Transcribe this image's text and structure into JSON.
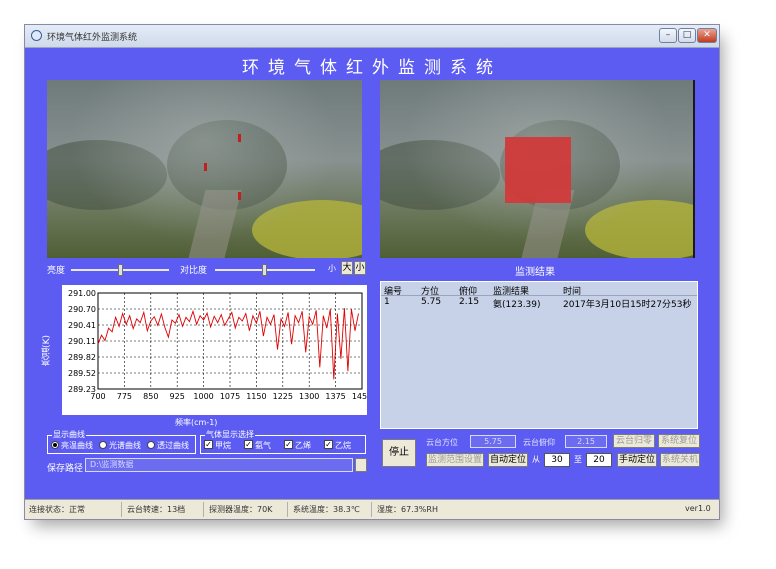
{
  "window": {
    "title": "环境气体红外监测系统"
  },
  "app_title": "环境气体红外监测系统",
  "video_controls": {
    "brightness_label": "亮度",
    "contrast_label": "对比度",
    "stepper_minus": "小",
    "stepper_plus": "大"
  },
  "result_panel": {
    "title": "监测结果",
    "columns": [
      "编号",
      "方位",
      "俯仰",
      "监测结果",
      "时间"
    ],
    "rows": [
      {
        "id": "1",
        "azimuth": "5.75",
        "pitch": "2.15",
        "result": "氨(123.39)",
        "time": "2017年3月10日15时27分53秒"
      }
    ]
  },
  "chart_data": {
    "type": "line",
    "xlabel": "频率(cm-1)",
    "ylabel": "亮温(K)",
    "xlim": [
      700,
      1450
    ],
    "ylim": [
      289.22,
      291.0
    ],
    "x_ticks": [
      "700",
      "775",
      "850",
      "925",
      "1000",
      "1075",
      "1150",
      "1225",
      "1300",
      "1375",
      "1450"
    ],
    "y_ticks": [
      "291.00",
      "290.70",
      "290.41",
      "290.11",
      "289.82",
      "289.52",
      "289.23"
    ],
    "grid": true,
    "series": [
      {
        "color": "#e00000",
        "x": [
          700,
          710,
          720,
          730,
          740,
          750,
          760,
          770,
          780,
          790,
          800,
          810,
          820,
          830,
          840,
          850,
          860,
          870,
          880,
          890,
          900,
          910,
          920,
          930,
          940,
          950,
          960,
          970,
          980,
          990,
          1000,
          1010,
          1020,
          1030,
          1040,
          1050,
          1060,
          1070,
          1080,
          1090,
          1100,
          1110,
          1120,
          1130,
          1140,
          1150,
          1160,
          1170,
          1180,
          1190,
          1200,
          1210,
          1220,
          1230,
          1240,
          1250,
          1260,
          1270,
          1280,
          1290,
          1300,
          1310,
          1320,
          1330,
          1340,
          1350,
          1360,
          1370,
          1380,
          1390,
          1400,
          1410,
          1420,
          1430,
          1440
        ],
        "y": [
          290.05,
          290.22,
          290.12,
          290.35,
          290.28,
          290.55,
          290.38,
          290.62,
          290.42,
          290.58,
          290.34,
          290.52,
          290.45,
          290.64,
          290.3,
          290.48,
          290.56,
          290.4,
          290.61,
          290.36,
          290.18,
          290.5,
          290.44,
          290.6,
          290.38,
          290.55,
          290.47,
          290.66,
          290.42,
          290.58,
          290.5,
          290.63,
          290.37,
          290.57,
          290.45,
          290.6,
          290.4,
          290.52,
          290.64,
          290.35,
          290.55,
          290.48,
          290.62,
          290.3,
          290.58,
          290.44,
          290.66,
          290.2,
          290.55,
          290.42,
          290.6,
          289.95,
          290.52,
          290.38,
          290.64,
          290.05,
          290.58,
          290.45,
          290.66,
          289.9,
          290.56,
          290.42,
          290.68,
          289.62,
          290.58,
          290.35,
          290.7,
          289.4,
          290.62,
          289.78,
          290.72,
          289.55,
          290.7,
          290.3,
          290.62
        ]
      }
    ]
  },
  "display_curve": {
    "legend": "显示曲线",
    "options": [
      "亮温曲线",
      "光谱曲线",
      "透过曲线"
    ],
    "selected": 0
  },
  "gas_display": {
    "legend": "气体显示选择",
    "options": [
      "甲烷",
      "氨气",
      "乙烯",
      "乙烷"
    ]
  },
  "save_path": {
    "label": "保存路径",
    "value": "D:\\监测数据"
  },
  "controls": {
    "stop_button": "停止",
    "azimuth_label": "云台方位",
    "azimuth_value": "5.75",
    "pitch_label": "云台俯仰",
    "pitch_value": "2.15",
    "cloud_center_button": "云台归零",
    "system_reset_button": "系统复位",
    "scan_range_button": "监测范围设置",
    "auto_locate_button": "自动定位",
    "from_label": "从",
    "from_value": "30",
    "to_label": "至",
    "to_value": "20",
    "manual_locate_button": "手动定位",
    "system_close_button": "系统关机"
  },
  "status": {
    "items": [
      "连接状态：正常",
      "云台转速：13档",
      "探测器温度：70K",
      "系统温度：38.3℃",
      "湿度：67.3%RH",
      "ver1.0"
    ]
  }
}
